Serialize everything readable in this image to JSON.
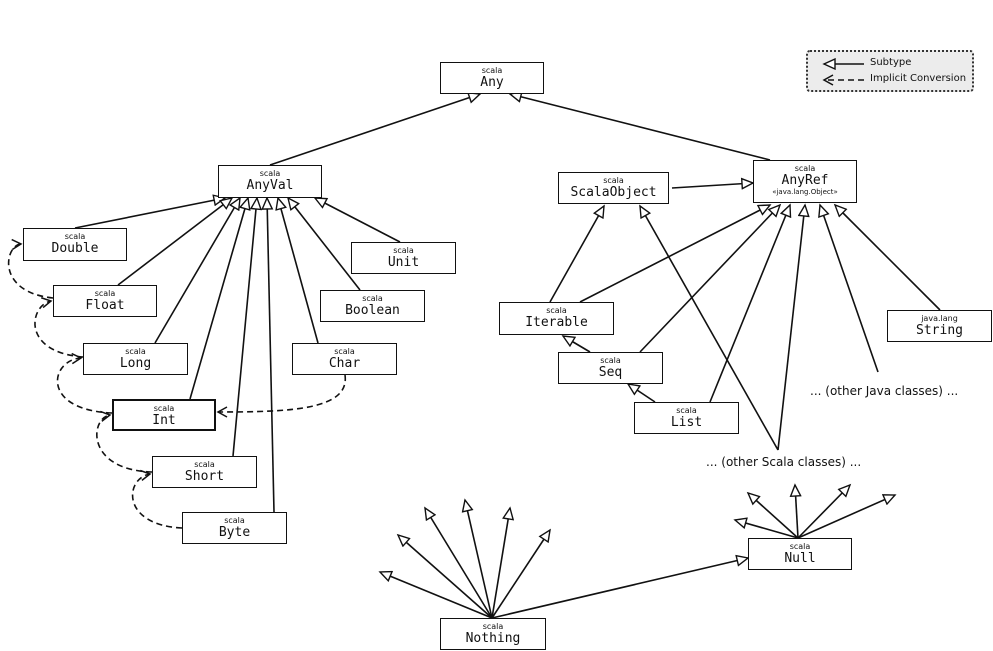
{
  "legend": {
    "subtype": "Subtype",
    "implicit": "Implicit Conversion"
  },
  "boxes": {
    "Any": {
      "pkg": "scala",
      "name": "Any"
    },
    "AnyVal": {
      "pkg": "scala",
      "name": "AnyVal"
    },
    "AnyRef": {
      "pkg": "scala",
      "name": "AnyRef",
      "note": "«java.lang.Object»"
    },
    "ScalaObject": {
      "pkg": "scala",
      "name": "ScalaObject"
    },
    "Double": {
      "pkg": "scala",
      "name": "Double"
    },
    "Unit": {
      "pkg": "scala",
      "name": "Unit"
    },
    "Float": {
      "pkg": "scala",
      "name": "Float"
    },
    "Boolean": {
      "pkg": "scala",
      "name": "Boolean"
    },
    "Iterable": {
      "pkg": "scala",
      "name": "Iterable"
    },
    "String": {
      "pkg": "java.lang",
      "name": "String"
    },
    "Long": {
      "pkg": "scala",
      "name": "Long"
    },
    "Char": {
      "pkg": "scala",
      "name": "Char"
    },
    "Seq": {
      "pkg": "scala",
      "name": "Seq"
    },
    "Int": {
      "pkg": "scala",
      "name": "Int"
    },
    "List": {
      "pkg": "scala",
      "name": "List"
    },
    "Short": {
      "pkg": "scala",
      "name": "Short"
    },
    "Byte": {
      "pkg": "scala",
      "name": "Byte"
    },
    "Null": {
      "pkg": "scala",
      "name": "Null"
    },
    "Nothing": {
      "pkg": "scala",
      "name": "Nothing"
    }
  },
  "labels": {
    "other_java": "... (other Java classes) ...",
    "other_scala": "... (other Scala classes) ..."
  },
  "subtype_edges": [
    [
      "AnyVal",
      "Any"
    ],
    [
      "AnyRef",
      "Any"
    ],
    [
      "ScalaObject",
      "AnyRef"
    ],
    [
      "Double",
      "AnyVal"
    ],
    [
      "Float",
      "AnyVal"
    ],
    [
      "Long",
      "AnyVal"
    ],
    [
      "Int",
      "AnyVal"
    ],
    [
      "Short",
      "AnyVal"
    ],
    [
      "Byte",
      "AnyVal"
    ],
    [
      "Char",
      "AnyVal"
    ],
    [
      "Boolean",
      "AnyVal"
    ],
    [
      "Unit",
      "AnyVal"
    ],
    [
      "Iterable",
      "ScalaObject"
    ],
    [
      "Iterable",
      "AnyRef"
    ],
    [
      "Seq",
      "AnyRef"
    ],
    [
      "List",
      "AnyRef"
    ],
    [
      "other_scala",
      "ScalaObject"
    ],
    [
      "other_scala",
      "AnyRef"
    ],
    [
      "other_java",
      "AnyRef"
    ],
    [
      "String",
      "AnyRef"
    ],
    [
      "Seq",
      "Iterable"
    ],
    [
      "List",
      "Seq"
    ],
    [
      "Nothing",
      "Null"
    ]
  ],
  "implicit_edges": [
    [
      "Byte",
      "Short"
    ],
    [
      "Short",
      "Int"
    ],
    [
      "Int",
      "Long"
    ],
    [
      "Long",
      "Float"
    ],
    [
      "Float",
      "Double"
    ],
    [
      "Char",
      "Int"
    ]
  ]
}
